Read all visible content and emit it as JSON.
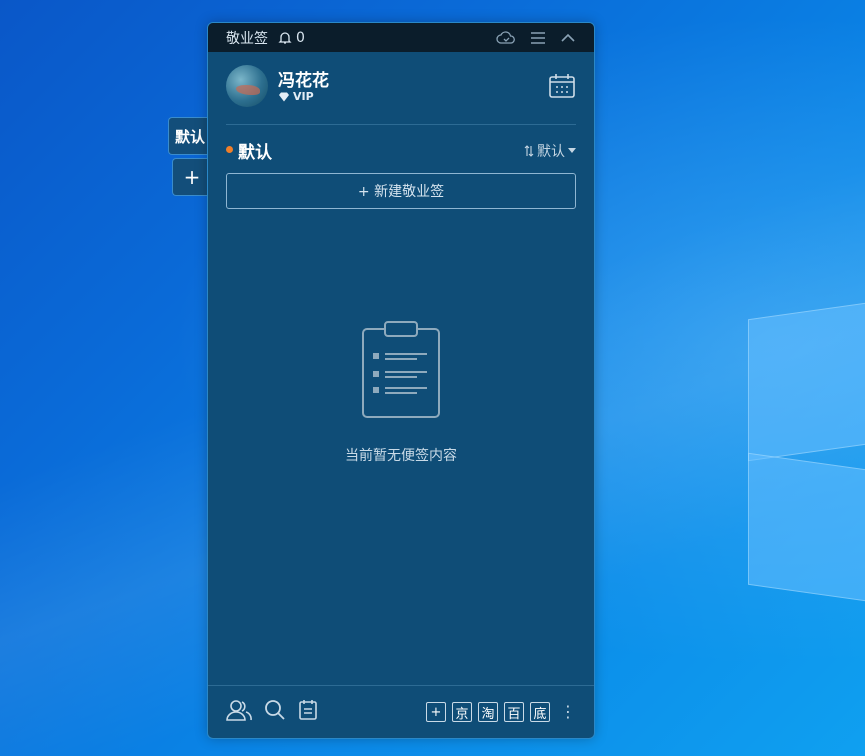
{
  "app": {
    "title": "敬业签",
    "notification_count": "0"
  },
  "profile": {
    "name": "冯花花",
    "badge": "VIP"
  },
  "side_tabs": {
    "active": "默认",
    "add": "+"
  },
  "list": {
    "category": "默认",
    "sort_label": "默认"
  },
  "new_button": "+ 新建敬业签",
  "empty_message": "当前暂无便签内容",
  "bottom": {
    "shortcuts": [
      "+",
      "京",
      "淘",
      "百",
      "底"
    ]
  },
  "colors": {
    "accent_dot": "#f07f2a",
    "window_bg": "#0f4d77",
    "titlebar_bg": "#0b1d2b"
  }
}
